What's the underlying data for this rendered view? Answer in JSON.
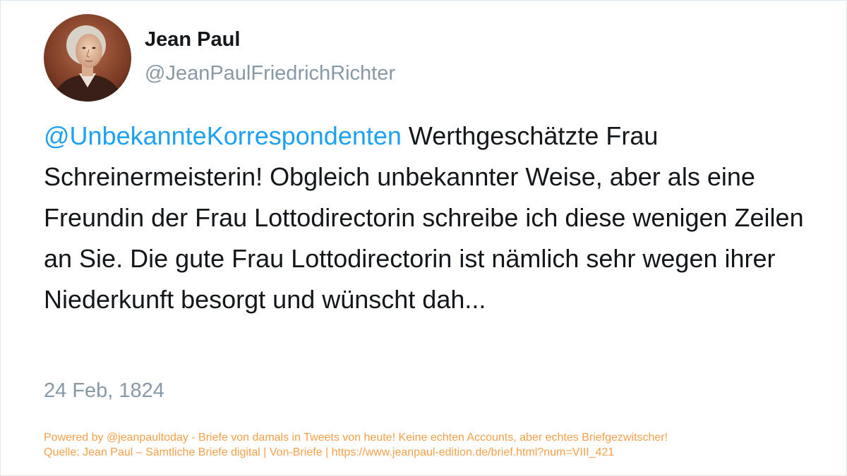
{
  "author": {
    "name": "Jean Paul",
    "handle": "@JeanPaulFriedrichRichter",
    "avatar_icon": "portrait-avatar"
  },
  "tweet": {
    "mention": "@UnbekannteKorrespondenten",
    "text": " Werthgeschätzte Frau Schreinermeisterin! Obgleich unbekannter Weise, aber als eine Freundin der Frau Lottodirectorin schreibe ich diese wenigen Zeilen an Sie. Die gute Frau Lottodirectorin ist nämlich sehr wegen ihrer Niederkunft besorgt und wünscht dah...",
    "date": "24 Feb, 1824"
  },
  "footer": {
    "line1": "Powered by @jeanpaultoday - Briefe von damals in Tweets von heute! Keine echten Accounts, aber echtes Briefgezwitscher!",
    "line2": "Quelle: Jean Paul – Sämtliche Briefe digital | Von-Briefe | https://www.jeanpaul-edition.de/brief.html?num=VIII_421"
  },
  "colors": {
    "mention": "#1da1f2",
    "text": "#14171a",
    "muted": "#8899a6",
    "footer": "#f5a04a"
  }
}
